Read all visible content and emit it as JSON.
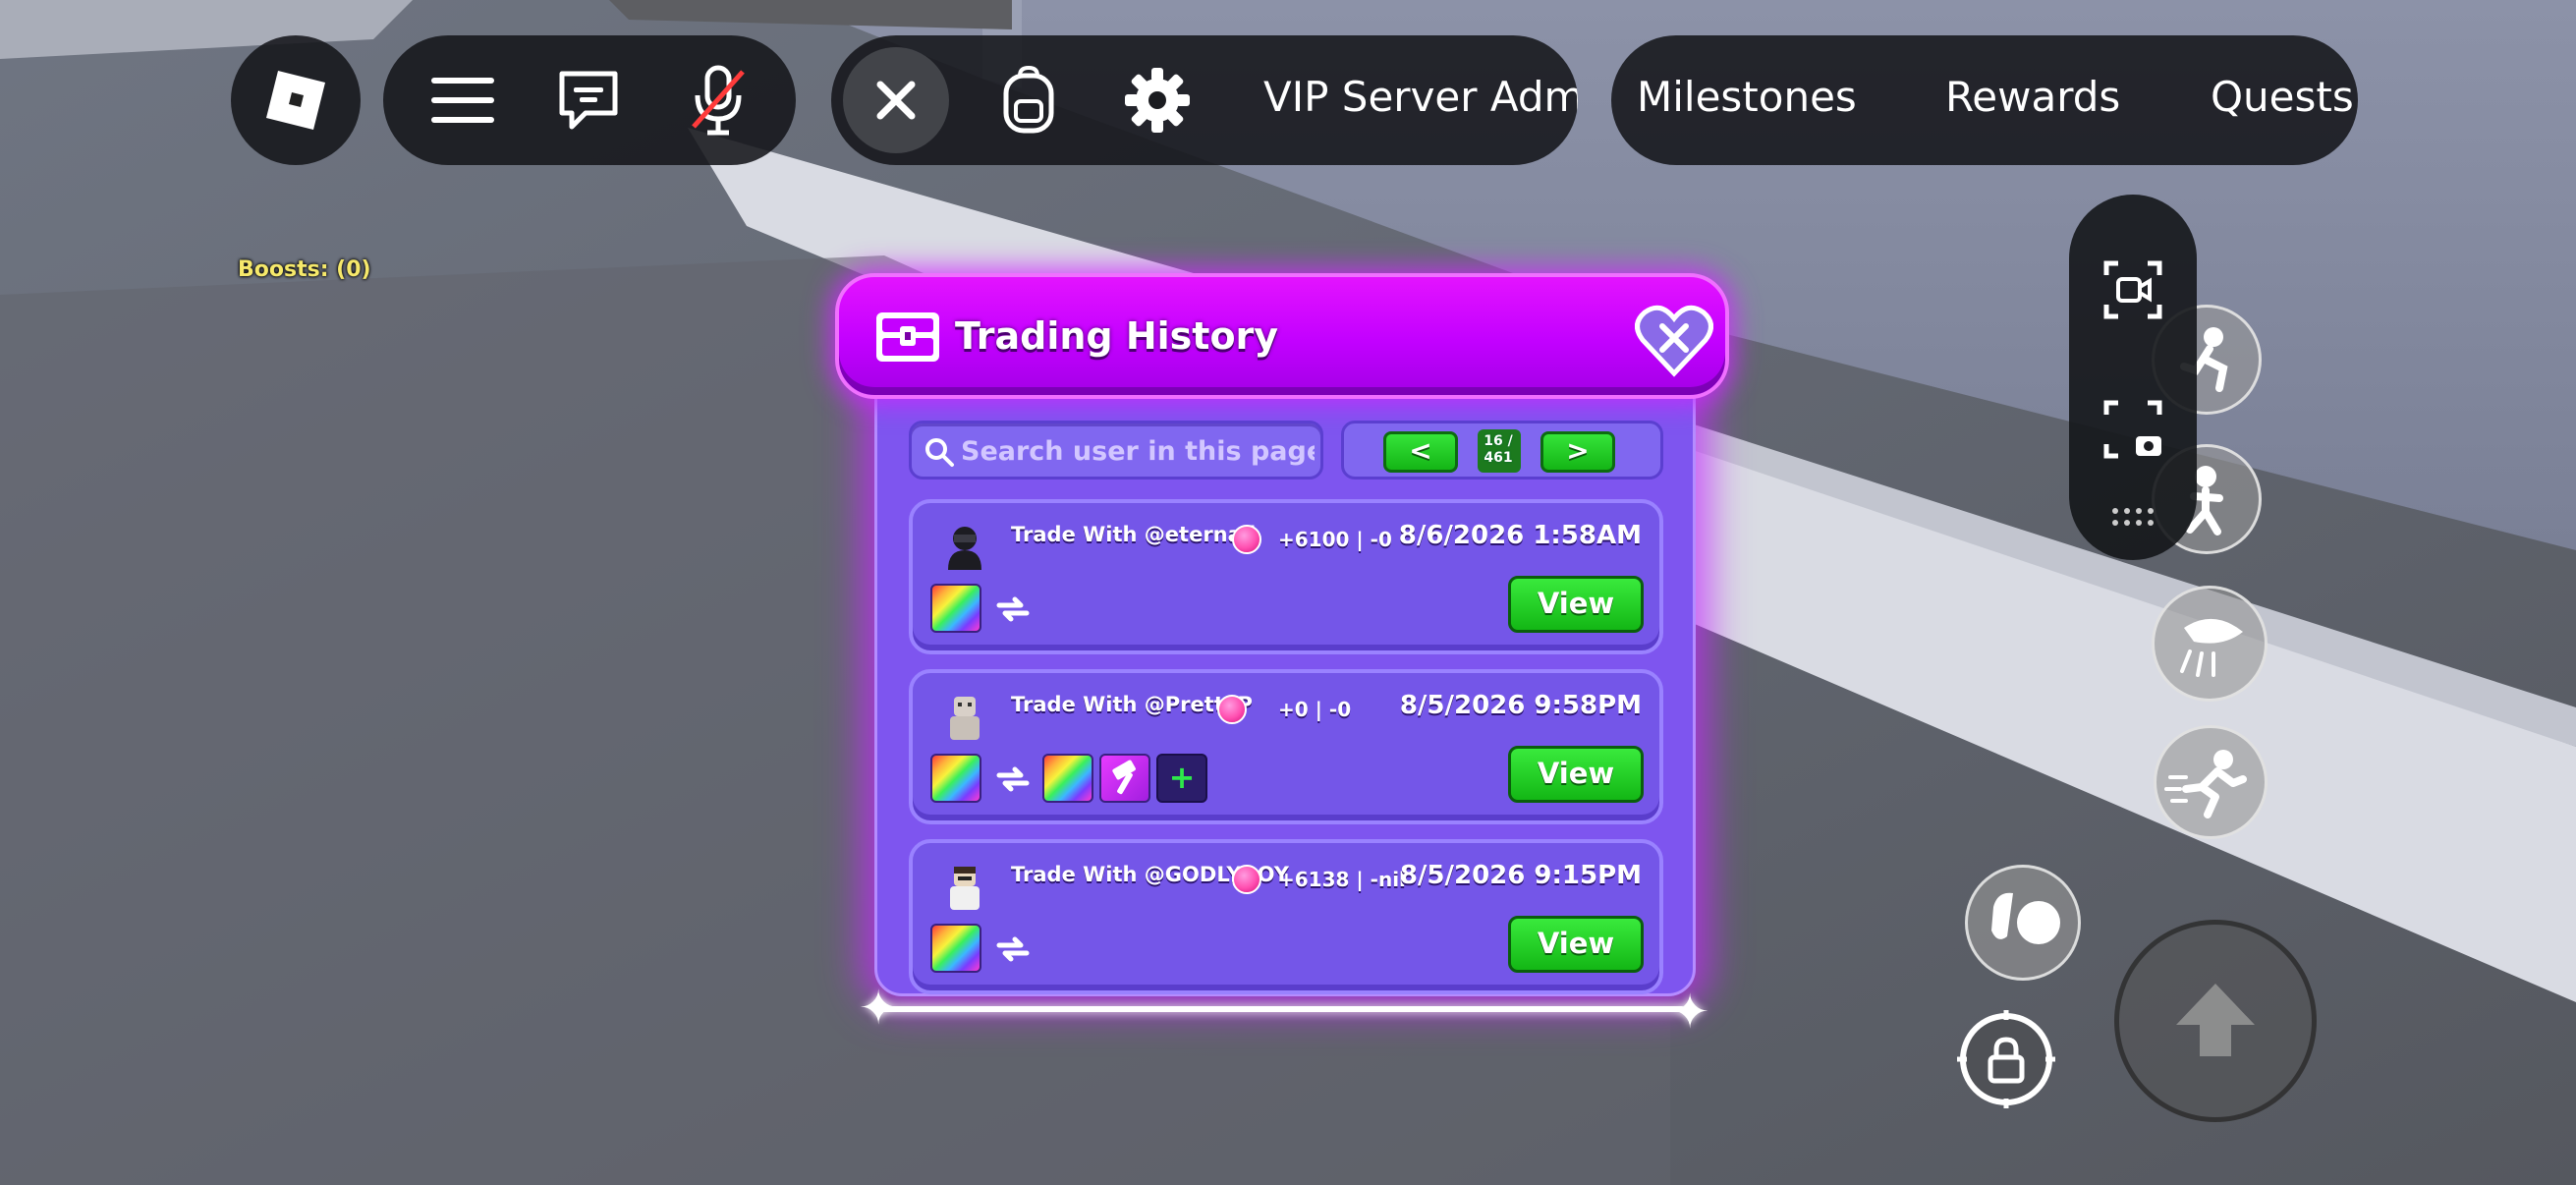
{
  "topbar": {
    "roblox_icon": "roblox-logo-icon",
    "menu_icon": "hamburger-menu-icon",
    "chat_icon": "chat-icon",
    "mic_icon": "microphone-muted-icon",
    "close_icon": "close-icon",
    "backpack_icon": "backpack-icon",
    "settings_icon": "gear-icon",
    "vip_label": "VIP Server Adm",
    "milestones_label": "Milestones",
    "rewards_label": "Rewards",
    "quests_label": "Quests"
  },
  "boosts_label": "Boosts: (0)",
  "trading": {
    "title": "Trading History",
    "search_placeholder": "Search user in this page",
    "pager": {
      "prev_label": "<",
      "next_label": ">",
      "count": "16 /\n461"
    },
    "rows": [
      {
        "trade_with": "Trade With @eternall",
        "diff": "+6100 | -0",
        "date": "8/6/2026 1:58AM",
        "view_label": "View"
      },
      {
        "trade_with": "Trade With @PrettyP",
        "diff": "+0 | -0",
        "date": "8/5/2026 9:58PM",
        "view_label": "View",
        "add_item_symbol": "+"
      },
      {
        "trade_with": "Trade With @GODLYBOY",
        "diff": "+6138 | -nil",
        "date": "8/5/2026 9:15PM",
        "view_label": "View"
      }
    ]
  },
  "colors": {
    "header_magenta": "#d400ff",
    "panel_purple": "#7e55ef",
    "view_green": "#22cc24",
    "boost_yellow": "#f6e96b"
  }
}
